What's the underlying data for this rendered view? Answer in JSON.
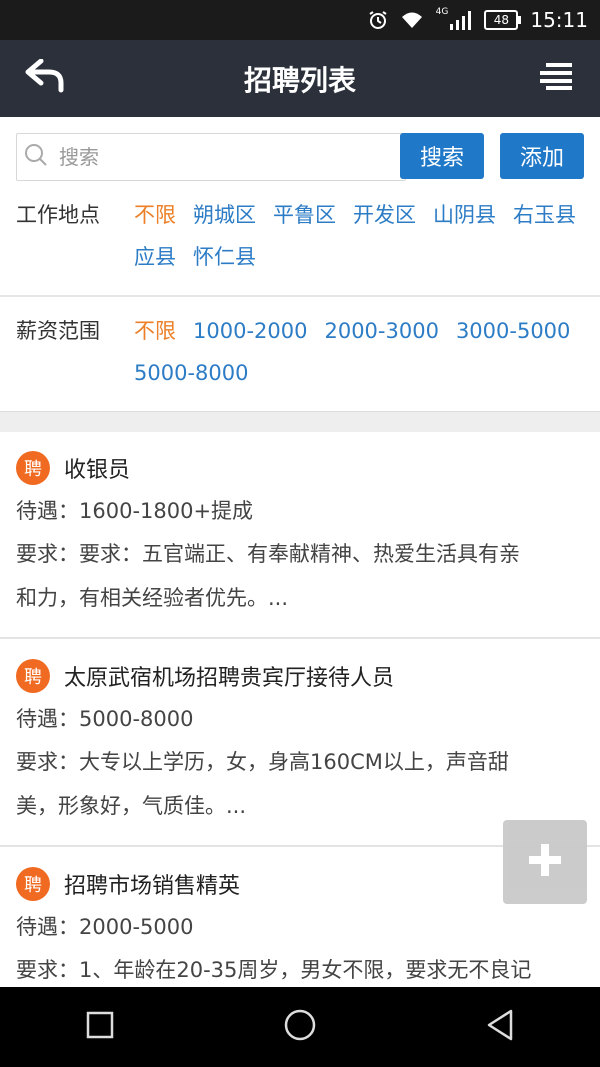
{
  "status_bar": {
    "network": "4G",
    "battery": "48",
    "time": "15:11"
  },
  "header": {
    "title": "招聘列表"
  },
  "search": {
    "placeholder": "搜索",
    "value": "",
    "search_button": "搜索",
    "add_button": "添加"
  },
  "filters": {
    "location": {
      "label": "工作地点",
      "options": [
        "不限",
        "朔城区",
        "平鲁区",
        "开发区",
        "山阴县",
        "右玉县",
        "应县",
        "怀仁县"
      ],
      "active": "不限"
    },
    "salary": {
      "label": "薪资范围",
      "options": [
        "不限",
        "1000-2000",
        "2000-3000",
        "3000-5000",
        "5000-8000"
      ],
      "active": "不限"
    }
  },
  "jobs": [
    {
      "badge": "聘",
      "title": "收银员",
      "salary_line": "待遇：1600-1800+提成",
      "req_line1": "要求：要求：五官端正、有奉献精神、热爱生活具有亲",
      "req_line2": "和力，有相关经验者优先。..."
    },
    {
      "badge": "聘",
      "title": "太原武宿机场招聘贵宾厅接待人员",
      "salary_line": "待遇：5000-8000",
      "req_line1": "要求：大专以上学历，女，身高160CM以上，声音甜",
      "req_line2": "美，形象好，气质佳。..."
    },
    {
      "badge": "聘",
      "title": "招聘市场销售精英",
      "salary_line": "待遇：2000-5000",
      "req_line1": "要求：1、年龄在20-35周岁，男女不限，要求无不良记"
    }
  ],
  "colors": {
    "header_bg": "#2b303b",
    "accent_blue": "#1f78c8",
    "link_blue": "#2d7cc6",
    "active_orange": "#ec7f27",
    "badge_orange": "#f06a21"
  },
  "icons": {
    "back": "back-arrow-icon",
    "menu": "menu-icon",
    "search": "search-icon",
    "fab": "plus-icon",
    "nav": [
      "recent-apps-icon",
      "home-icon",
      "back-triangle-icon"
    ]
  }
}
